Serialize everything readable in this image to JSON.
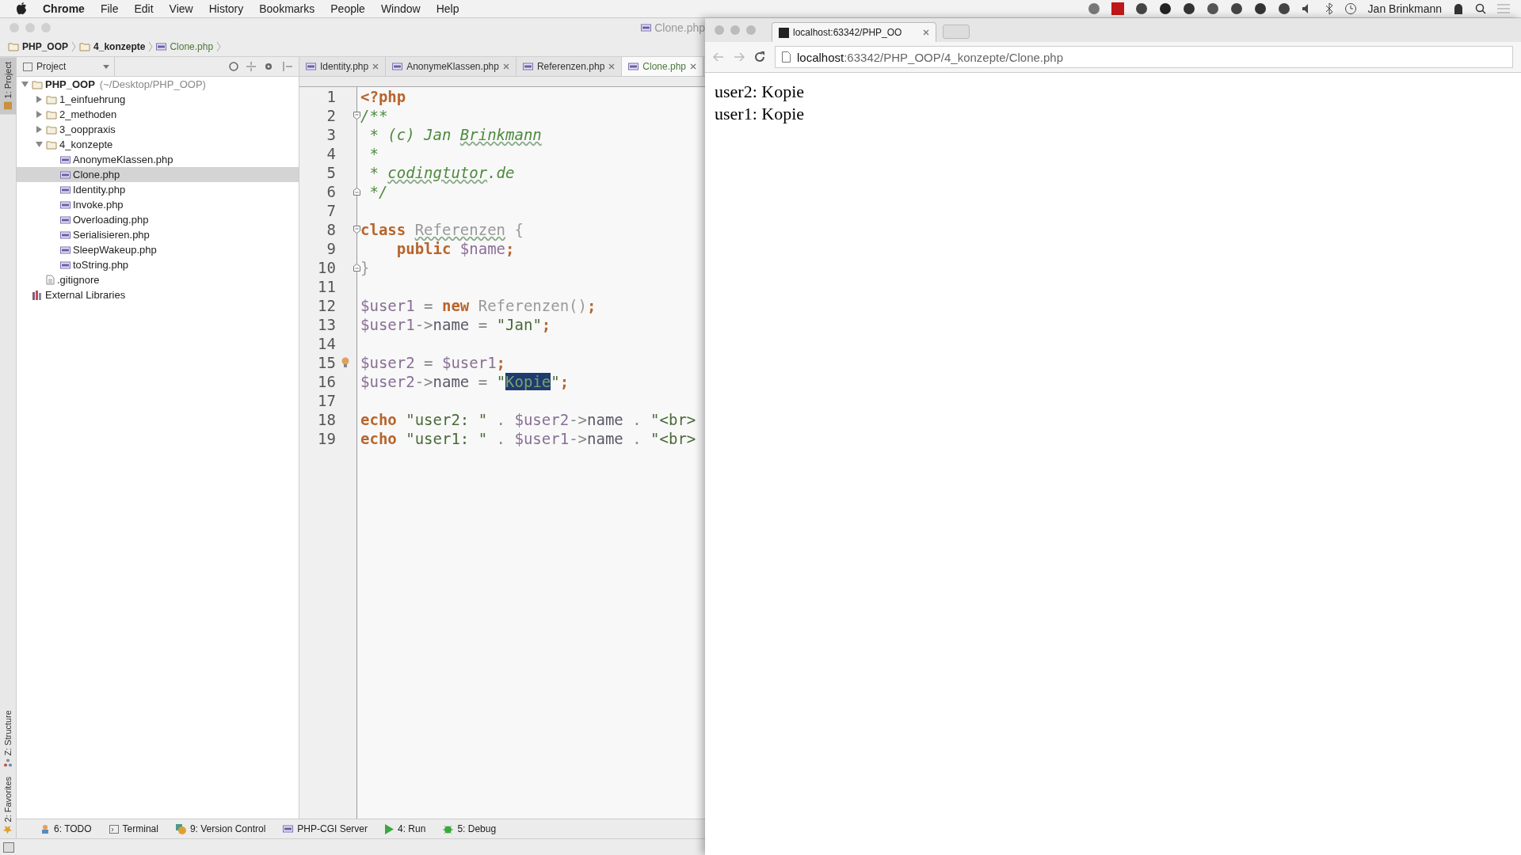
{
  "menu_bar": {
    "app": "Chrome",
    "items": [
      "File",
      "Edit",
      "View",
      "History",
      "Bookmarks",
      "People",
      "Window",
      "Help"
    ],
    "user": "Jan Brinkmann"
  },
  "ide": {
    "title": "Clone.php",
    "breadcrumb": [
      {
        "label": "PHP_OOP",
        "kind": "folder"
      },
      {
        "label": "4_konzepte",
        "kind": "folder"
      },
      {
        "label": "Clone.php",
        "kind": "file"
      }
    ],
    "side_tabs": [
      {
        "label": "1: Project",
        "selected": true,
        "kind": "project"
      },
      {
        "label": "Z: Structure",
        "selected": false,
        "kind": "structure"
      },
      {
        "label": "2: Favorites",
        "selected": false,
        "kind": "favorites"
      }
    ],
    "project_panel": {
      "title": "Project",
      "tree": [
        {
          "name": "PHP_OOP",
          "path": "(~/Desktop/PHP_OOP)",
          "kind": "folder",
          "expanded": true,
          "selected": false,
          "children": [
            {
              "name": "1_einfuehrung",
              "kind": "folder",
              "expanded": false,
              "selected": false
            },
            {
              "name": "2_methoden",
              "kind": "folder",
              "expanded": false,
              "selected": false
            },
            {
              "name": "3_ooppraxis",
              "kind": "folder",
              "expanded": false,
              "selected": false
            },
            {
              "name": "4_konzepte",
              "kind": "folder",
              "expanded": true,
              "selected": false,
              "children": [
                {
                  "name": "AnonymeKlassen.php",
                  "kind": "php",
                  "selected": false
                },
                {
                  "name": "Clone.php",
                  "kind": "php",
                  "selected": true
                },
                {
                  "name": "Identity.php",
                  "kind": "php",
                  "selected": false
                },
                {
                  "name": "Invoke.php",
                  "kind": "php",
                  "selected": false
                },
                {
                  "name": "Overloading.php",
                  "kind": "php",
                  "selected": false
                },
                {
                  "name": "Serialisieren.php",
                  "kind": "php",
                  "selected": false
                },
                {
                  "name": "SleepWakeup.php",
                  "kind": "php",
                  "selected": false
                },
                {
                  "name": "toString.php",
                  "kind": "php",
                  "selected": false
                }
              ]
            },
            {
              "name": ".gitignore",
              "kind": "text",
              "selected": false
            }
          ]
        },
        {
          "name": "External Libraries",
          "kind": "library",
          "selected": false
        }
      ]
    },
    "editor_tabs": [
      {
        "label": "Identity.php",
        "selected": false
      },
      {
        "label": "AnonymeKlassen.php",
        "selected": false
      },
      {
        "label": "Referenzen.php",
        "selected": false
      },
      {
        "label": "Clone.php",
        "selected": true
      }
    ],
    "code_lines": [
      {
        "number": "1",
        "kind": "plain",
        "tokens": [
          {
            "kind": "kw",
            "text": "<?php"
          }
        ]
      },
      {
        "number": "2",
        "kind": "fold_start",
        "tokens": [
          {
            "kind": "cmt",
            "text": "/**"
          }
        ]
      },
      {
        "number": "3",
        "kind": "plain",
        "tokens": [
          {
            "kind": "cmt",
            "text": " * (c) Jan "
          },
          {
            "kind": "cmt",
            "text": "Brinkmann",
            "typo": true
          }
        ]
      },
      {
        "number": "4",
        "kind": "plain",
        "tokens": [
          {
            "kind": "cmt",
            "text": " *"
          }
        ]
      },
      {
        "number": "5",
        "kind": "plain",
        "tokens": [
          {
            "kind": "cmt",
            "text": " * "
          },
          {
            "kind": "cmt",
            "text": "codingtutor",
            "typo": true
          },
          {
            "kind": "cmt",
            "text": ".de"
          }
        ]
      },
      {
        "number": "6",
        "kind": "fold_end",
        "tokens": [
          {
            "kind": "cmt",
            "text": " */"
          }
        ]
      },
      {
        "number": "7",
        "kind": "plain"
      },
      {
        "number": "8",
        "kind": "fold_start",
        "tokens": [
          {
            "kind": "kw",
            "text": "class "
          },
          {
            "kind": "cls",
            "text": "Referenzen",
            "typo": true
          },
          {
            "kind": "cls",
            "text": " {"
          }
        ]
      },
      {
        "number": "9",
        "kind": "plain",
        "tokens": [
          {
            "kind": "kw",
            "text": "    public "
          },
          {
            "kind": "var",
            "text": "$name"
          },
          {
            "kind": "semi",
            "text": ";"
          }
        ]
      },
      {
        "number": "10",
        "kind": "fold_end",
        "tokens": [
          {
            "kind": "cls",
            "text": "}"
          }
        ]
      },
      {
        "number": "11",
        "kind": "plain"
      },
      {
        "number": "12",
        "kind": "plain",
        "tokens": [
          {
            "kind": "var",
            "text": "$user1"
          },
          {
            "kind": "op",
            "text": " = "
          },
          {
            "kind": "kw",
            "text": "new "
          },
          {
            "kind": "cls",
            "text": "Referenzen()"
          },
          {
            "kind": "semi",
            "text": ";"
          }
        ]
      },
      {
        "number": "13",
        "kind": "plain",
        "tokens": [
          {
            "kind": "var",
            "text": "$user1"
          },
          {
            "kind": "op",
            "text": "->"
          },
          {
            "kind": "plain",
            "text": "name"
          },
          {
            "kind": "op",
            "text": " = "
          },
          {
            "kind": "str",
            "text": "\"Jan\""
          },
          {
            "kind": "semi",
            "text": ";"
          }
        ]
      },
      {
        "number": "14",
        "kind": "plain"
      },
      {
        "number": "15",
        "kind": "plain",
        "tokens": [
          {
            "kind": "var",
            "text": "$user2"
          },
          {
            "kind": "op",
            "text": " = "
          },
          {
            "kind": "var",
            "text": "$user1"
          },
          {
            "kind": "semi",
            "text": ";"
          }
        ]
      },
      {
        "number": "16",
        "kind": "plain",
        "tokens": [
          {
            "kind": "var",
            "text": "$user2"
          },
          {
            "kind": "op",
            "text": "->"
          },
          {
            "kind": "plain",
            "text": "name"
          },
          {
            "kind": "op",
            "text": " = "
          },
          {
            "kind": "str",
            "text": "\""
          },
          {
            "kind": "sel",
            "text": "Kopie"
          },
          {
            "kind": "str",
            "text": "\""
          },
          {
            "kind": "semi",
            "text": ";"
          }
        ]
      },
      {
        "number": "17",
        "kind": "plain"
      },
      {
        "number": "18",
        "kind": "plain",
        "tokens": [
          {
            "kind": "kw",
            "text": "echo "
          },
          {
            "kind": "str",
            "text": "\"user2: \""
          },
          {
            "kind": "op",
            "text": " . "
          },
          {
            "kind": "var",
            "text": "$user2"
          },
          {
            "kind": "op",
            "text": "->"
          },
          {
            "kind": "plain",
            "text": "name"
          },
          {
            "kind": "op",
            "text": " . "
          },
          {
            "kind": "str",
            "text": "\"<br>"
          }
        ]
      },
      {
        "number": "19",
        "kind": "plain",
        "tokens": [
          {
            "kind": "kw",
            "text": "echo "
          },
          {
            "kind": "str",
            "text": "\"user1: \""
          },
          {
            "kind": "op",
            "text": " . "
          },
          {
            "kind": "var",
            "text": "$user1"
          },
          {
            "kind": "op",
            "text": "->"
          },
          {
            "kind": "plain",
            "text": "name"
          },
          {
            "kind": "op",
            "text": " . "
          },
          {
            "kind": "str",
            "text": "\"<br>"
          }
        ]
      }
    ],
    "bottom_tools": [
      {
        "label": "6: TODO",
        "kind": "todo"
      },
      {
        "label": "Terminal",
        "kind": "terminal"
      },
      {
        "label": "9: Version Control",
        "kind": "vcs"
      },
      {
        "label": "PHP-CGI Server",
        "kind": "php"
      },
      {
        "label": "4: Run",
        "kind": "run"
      },
      {
        "label": "5: Debug",
        "kind": "debug"
      }
    ]
  },
  "browser": {
    "tab_title": "localhost:63342/PHP_OO",
    "url_host": "localhost",
    "url_rest": ":63342/PHP_OOP/4_konzepte/Clone.php",
    "output": [
      "user2: Kopie",
      "user1: Kopie"
    ]
  }
}
